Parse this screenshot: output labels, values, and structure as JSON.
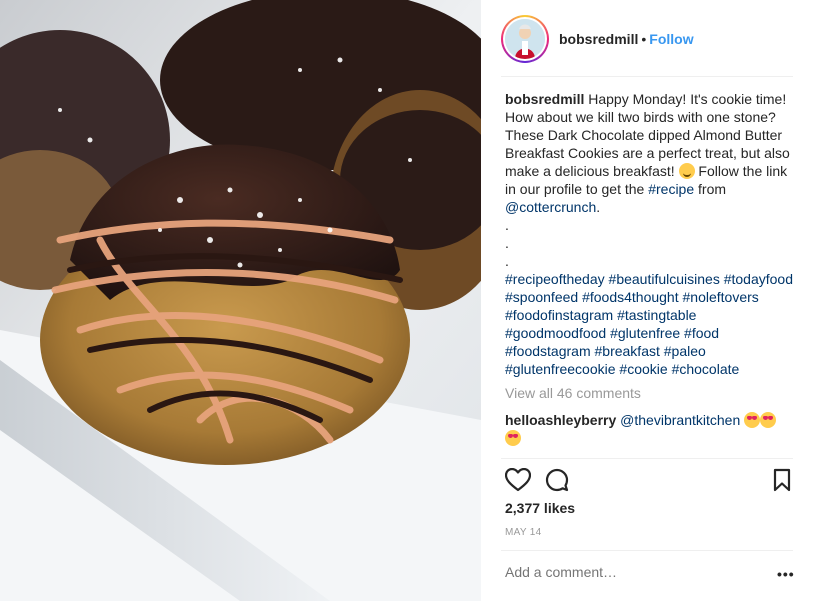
{
  "post": {
    "photo_alt": "Dark chocolate dipped almond butter breakfast cookies",
    "username": "bobsredmill",
    "dot": "•",
    "follow_label": "Follow",
    "caption": {
      "user": "bobsredmill",
      "text1": "Happy Monday! It's cookie time! How about we kill two birds with one stone? These Dark Chocolate dipped Almond Butter Breakfast Cookies are a perfect treat, but also make a delicious breakfast! ",
      "text2": " Follow the link in our profile to get the ",
      "hashtag_recipe": "#recipe",
      "text3": " from ",
      "mention": "@cottercrunch",
      "text4": ".",
      "dots": [
        ".",
        ".",
        "."
      ],
      "hashtags": [
        "#recipeoftheday",
        "#beautifulcuisines",
        "#todayfood",
        "#spoonfeed",
        "#foods4thought",
        "#noleftovers",
        "#foodofinstagram",
        "#tastingtable",
        "#goodmoodfood",
        "#glutenfree",
        "#food",
        "#foodstagram",
        "#breakfast",
        "#paleo",
        "#glutenfreecookie",
        "#cookie",
        "#chocolate"
      ]
    },
    "view_all_comments": "View all 46 comments",
    "comments": [
      {
        "user": "helloashleyberry",
        "mention": "@thevibrantkitchen"
      }
    ],
    "likes": "2,377 likes",
    "date": "MAY 14",
    "add_comment_placeholder": "Add a comment…",
    "more_label": "•••"
  },
  "colors": {
    "accent": "#3897f0",
    "link": "#003569",
    "muted": "#999999",
    "text": "#262626"
  },
  "icons": [
    "heart-icon",
    "comment-icon",
    "bookmark-icon"
  ]
}
